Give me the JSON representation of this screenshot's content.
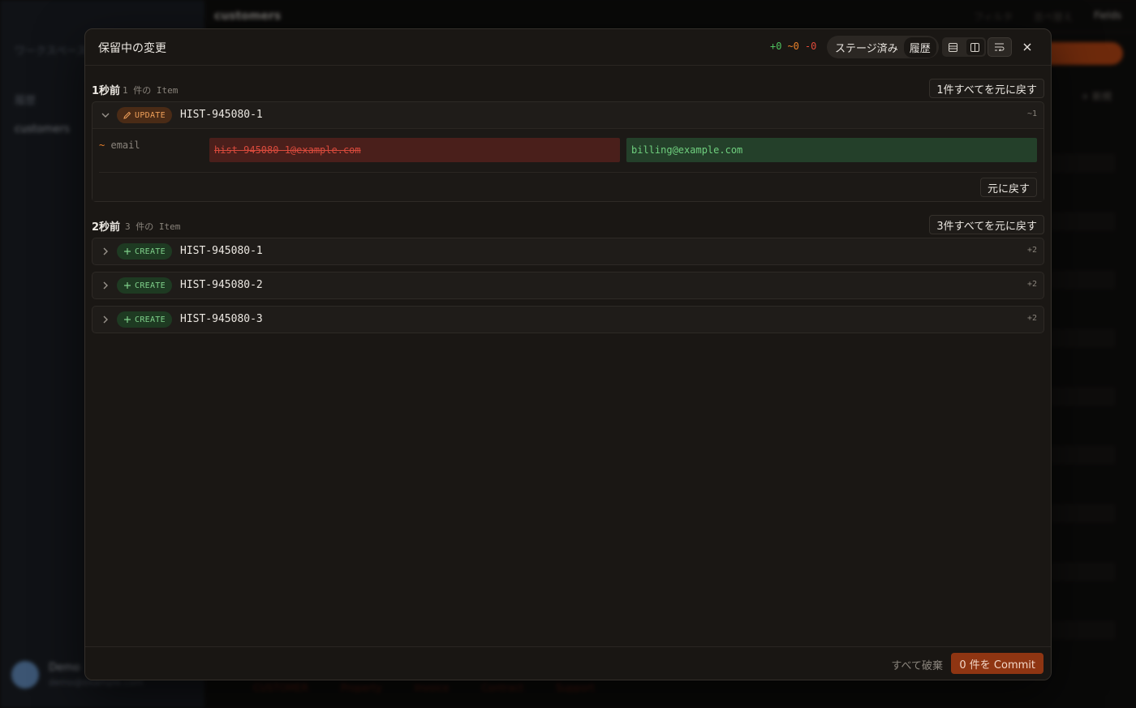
{
  "background": {
    "sidebar": {
      "workspace": "ワークスペース",
      "items": [
        "履歴",
        "customers"
      ],
      "user": {
        "name": "Demo",
        "email": "demo@example.com"
      }
    },
    "topbar": {
      "title": "customers",
      "buttons": [
        "フィルタ",
        "並べ替え",
        "Fields"
      ]
    },
    "add_label": "+ 新規",
    "bottom_tabs": [
      "CUSTOMER",
      "Property",
      "Invoice",
      "Contract",
      "Support"
    ]
  },
  "modal": {
    "title": "保留中の変更",
    "counts": {
      "added": "+0",
      "modified": "~0",
      "deleted": "-0"
    },
    "tabs": [
      {
        "label": "ステージ済み",
        "active": false
      },
      {
        "label": "履歴",
        "active": true
      }
    ],
    "view_icons": [
      "list-view-icon",
      "split-view-icon",
      "wrap-lines-icon"
    ],
    "groups": [
      {
        "time": "1秒前",
        "count": "1 件の Item",
        "revert_label": "1件すべてを元に戻す",
        "items": [
          {
            "op": "UPDATE",
            "id": "HIST-945080-1",
            "delta": "~1",
            "expanded": true,
            "fields": [
              {
                "name": "email",
                "old": "hist-945080-1@example.com",
                "new": "billing@example.com"
              }
            ],
            "revert_label": "元に戻す"
          }
        ]
      },
      {
        "time": "2秒前",
        "count": "3 件の Item",
        "revert_label": "3件すべてを元に戻す",
        "items": [
          {
            "op": "CREATE",
            "id": "HIST-945080-1",
            "delta": "+2",
            "expanded": false
          },
          {
            "op": "CREATE",
            "id": "HIST-945080-2",
            "delta": "+2",
            "expanded": false
          },
          {
            "op": "CREATE",
            "id": "HIST-945080-3",
            "delta": "+2",
            "expanded": false
          }
        ]
      }
    ],
    "footer": {
      "discard_label": "すべて破棄",
      "commit_label": "0 件を Commit"
    }
  },
  "colors": {
    "accent": "#c94d16",
    "added": "#4ec15e",
    "modified": "#e8802a",
    "deleted": "#e04a3a"
  }
}
